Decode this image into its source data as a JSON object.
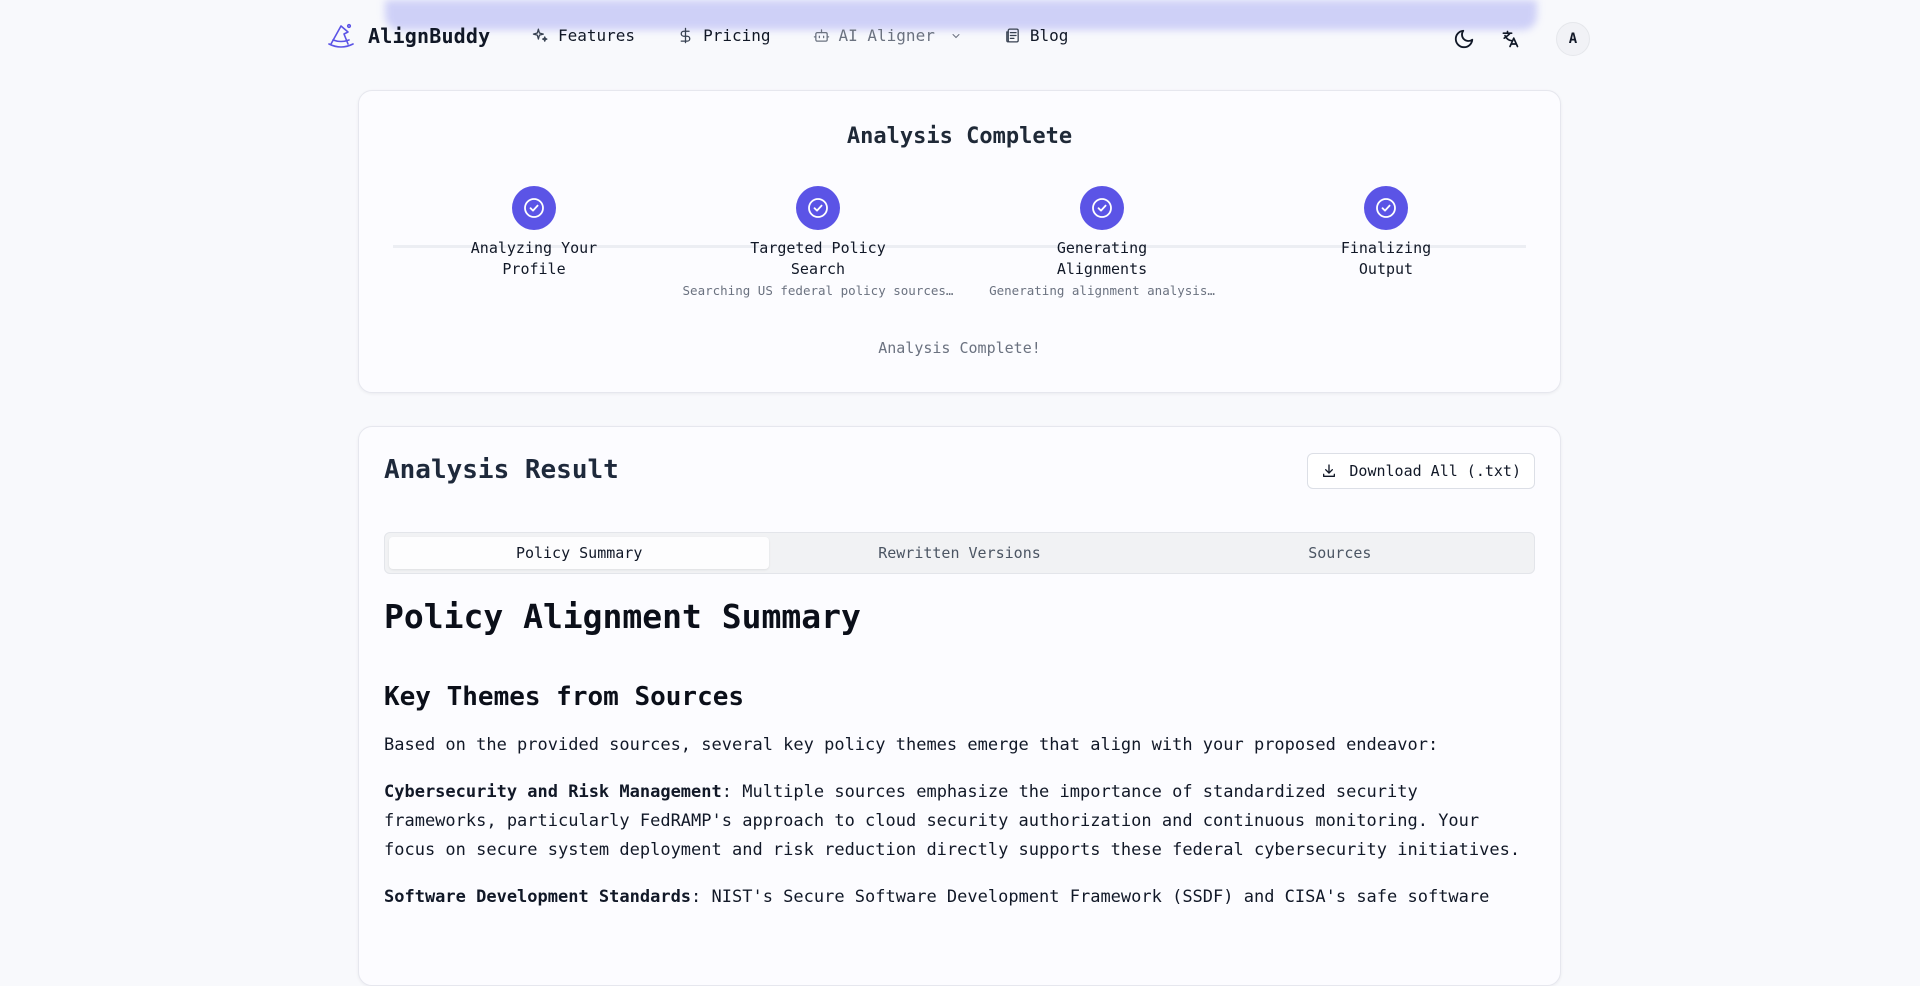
{
  "header": {
    "brand": "AlignBuddy",
    "nav": [
      {
        "label": "Features",
        "icon": "sparkles-icon"
      },
      {
        "label": "Pricing",
        "icon": "dollar-icon"
      },
      {
        "label": "AI Aligner",
        "icon": "bot-icon"
      },
      {
        "label": "Blog",
        "icon": "newspaper-icon"
      }
    ],
    "avatar_initial": "A"
  },
  "progress": {
    "title": "Analysis Complete",
    "steps": [
      {
        "label": "Analyzing Your\nProfile",
        "sub": ""
      },
      {
        "label": "Targeted Policy\nSearch",
        "sub": "Searching US federal policy sources…"
      },
      {
        "label": "Generating\nAlignments",
        "sub": "Generating alignment analysis…"
      },
      {
        "label": "Finalizing\nOutput",
        "sub": ""
      }
    ],
    "status": "Analysis Complete!"
  },
  "result": {
    "title": "Analysis Result",
    "download_label": "Download All (.txt)",
    "tabs": [
      "Policy Summary",
      "Rewritten Versions",
      "Sources"
    ],
    "active_tab": "Policy Summary"
  },
  "content": {
    "h1": "Policy Alignment Summary",
    "h2": "Key Themes from Sources",
    "intro": "Based on the provided sources, several key policy themes emerge that align with your proposed endeavor:",
    "items": [
      {
        "term": "Cybersecurity and Risk Management",
        "text": ": Multiple sources emphasize the importance of standardized security frameworks, particularly FedRAMP's approach to cloud security authorization and continuous monitoring. Your focus on secure system deployment and risk reduction directly supports these federal cybersecurity initiatives."
      },
      {
        "term": "Software Development Standards",
        "text": ": NIST's Secure Software Development Framework (SSDF) and CISA's safe software"
      }
    ]
  },
  "colors": {
    "accent": "#5b54e6"
  }
}
